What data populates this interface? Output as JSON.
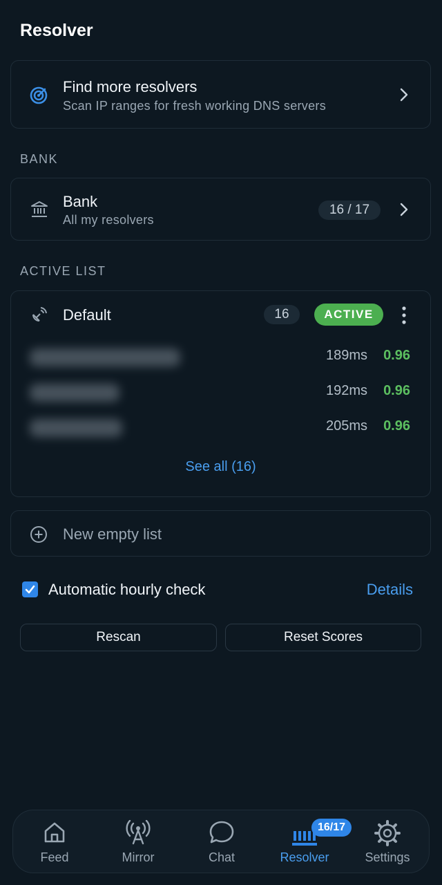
{
  "page": {
    "title": "Resolver"
  },
  "find_card": {
    "title": "Find more resolvers",
    "subtitle": "Scan IP ranges for fresh working DNS servers",
    "icon": "radar-icon"
  },
  "bank_section": {
    "label": "BANK",
    "card": {
      "title": "Bank",
      "subtitle": "All my resolvers",
      "count": "16 / 17",
      "icon": "bank-icon"
    }
  },
  "active_section": {
    "label": "ACTIVE LIST",
    "list": {
      "name": "Default",
      "count": "16",
      "status": "ACTIVE",
      "icon": "satellite-dish-icon",
      "resolvers": [
        {
          "latency": "189ms",
          "score": "0.96"
        },
        {
          "latency": "192ms",
          "score": "0.96"
        },
        {
          "latency": "205ms",
          "score": "0.96"
        }
      ],
      "see_all": "See all (16)"
    }
  },
  "new_list": {
    "label": "New empty list",
    "icon": "plus-circle-icon"
  },
  "auto_check": {
    "label": "Automatic hourly check",
    "checked": true,
    "details": "Details"
  },
  "buttons": {
    "rescan": "Rescan",
    "reset_scores": "Reset Scores"
  },
  "tabbar": {
    "tabs": [
      {
        "label": "Feed",
        "icon": "home-icon"
      },
      {
        "label": "Mirror",
        "icon": "antenna-icon"
      },
      {
        "label": "Chat",
        "icon": "chat-bubble-icon"
      },
      {
        "label": "Resolver",
        "icon": "bank-icon",
        "badge": "16/17",
        "active": true
      },
      {
        "label": "Settings",
        "icon": "gear-icon"
      }
    ]
  },
  "colors": {
    "background": "#0d1821",
    "accent": "#4a9eef",
    "active_green": "#4caf50",
    "score_green": "#5cbf60"
  }
}
